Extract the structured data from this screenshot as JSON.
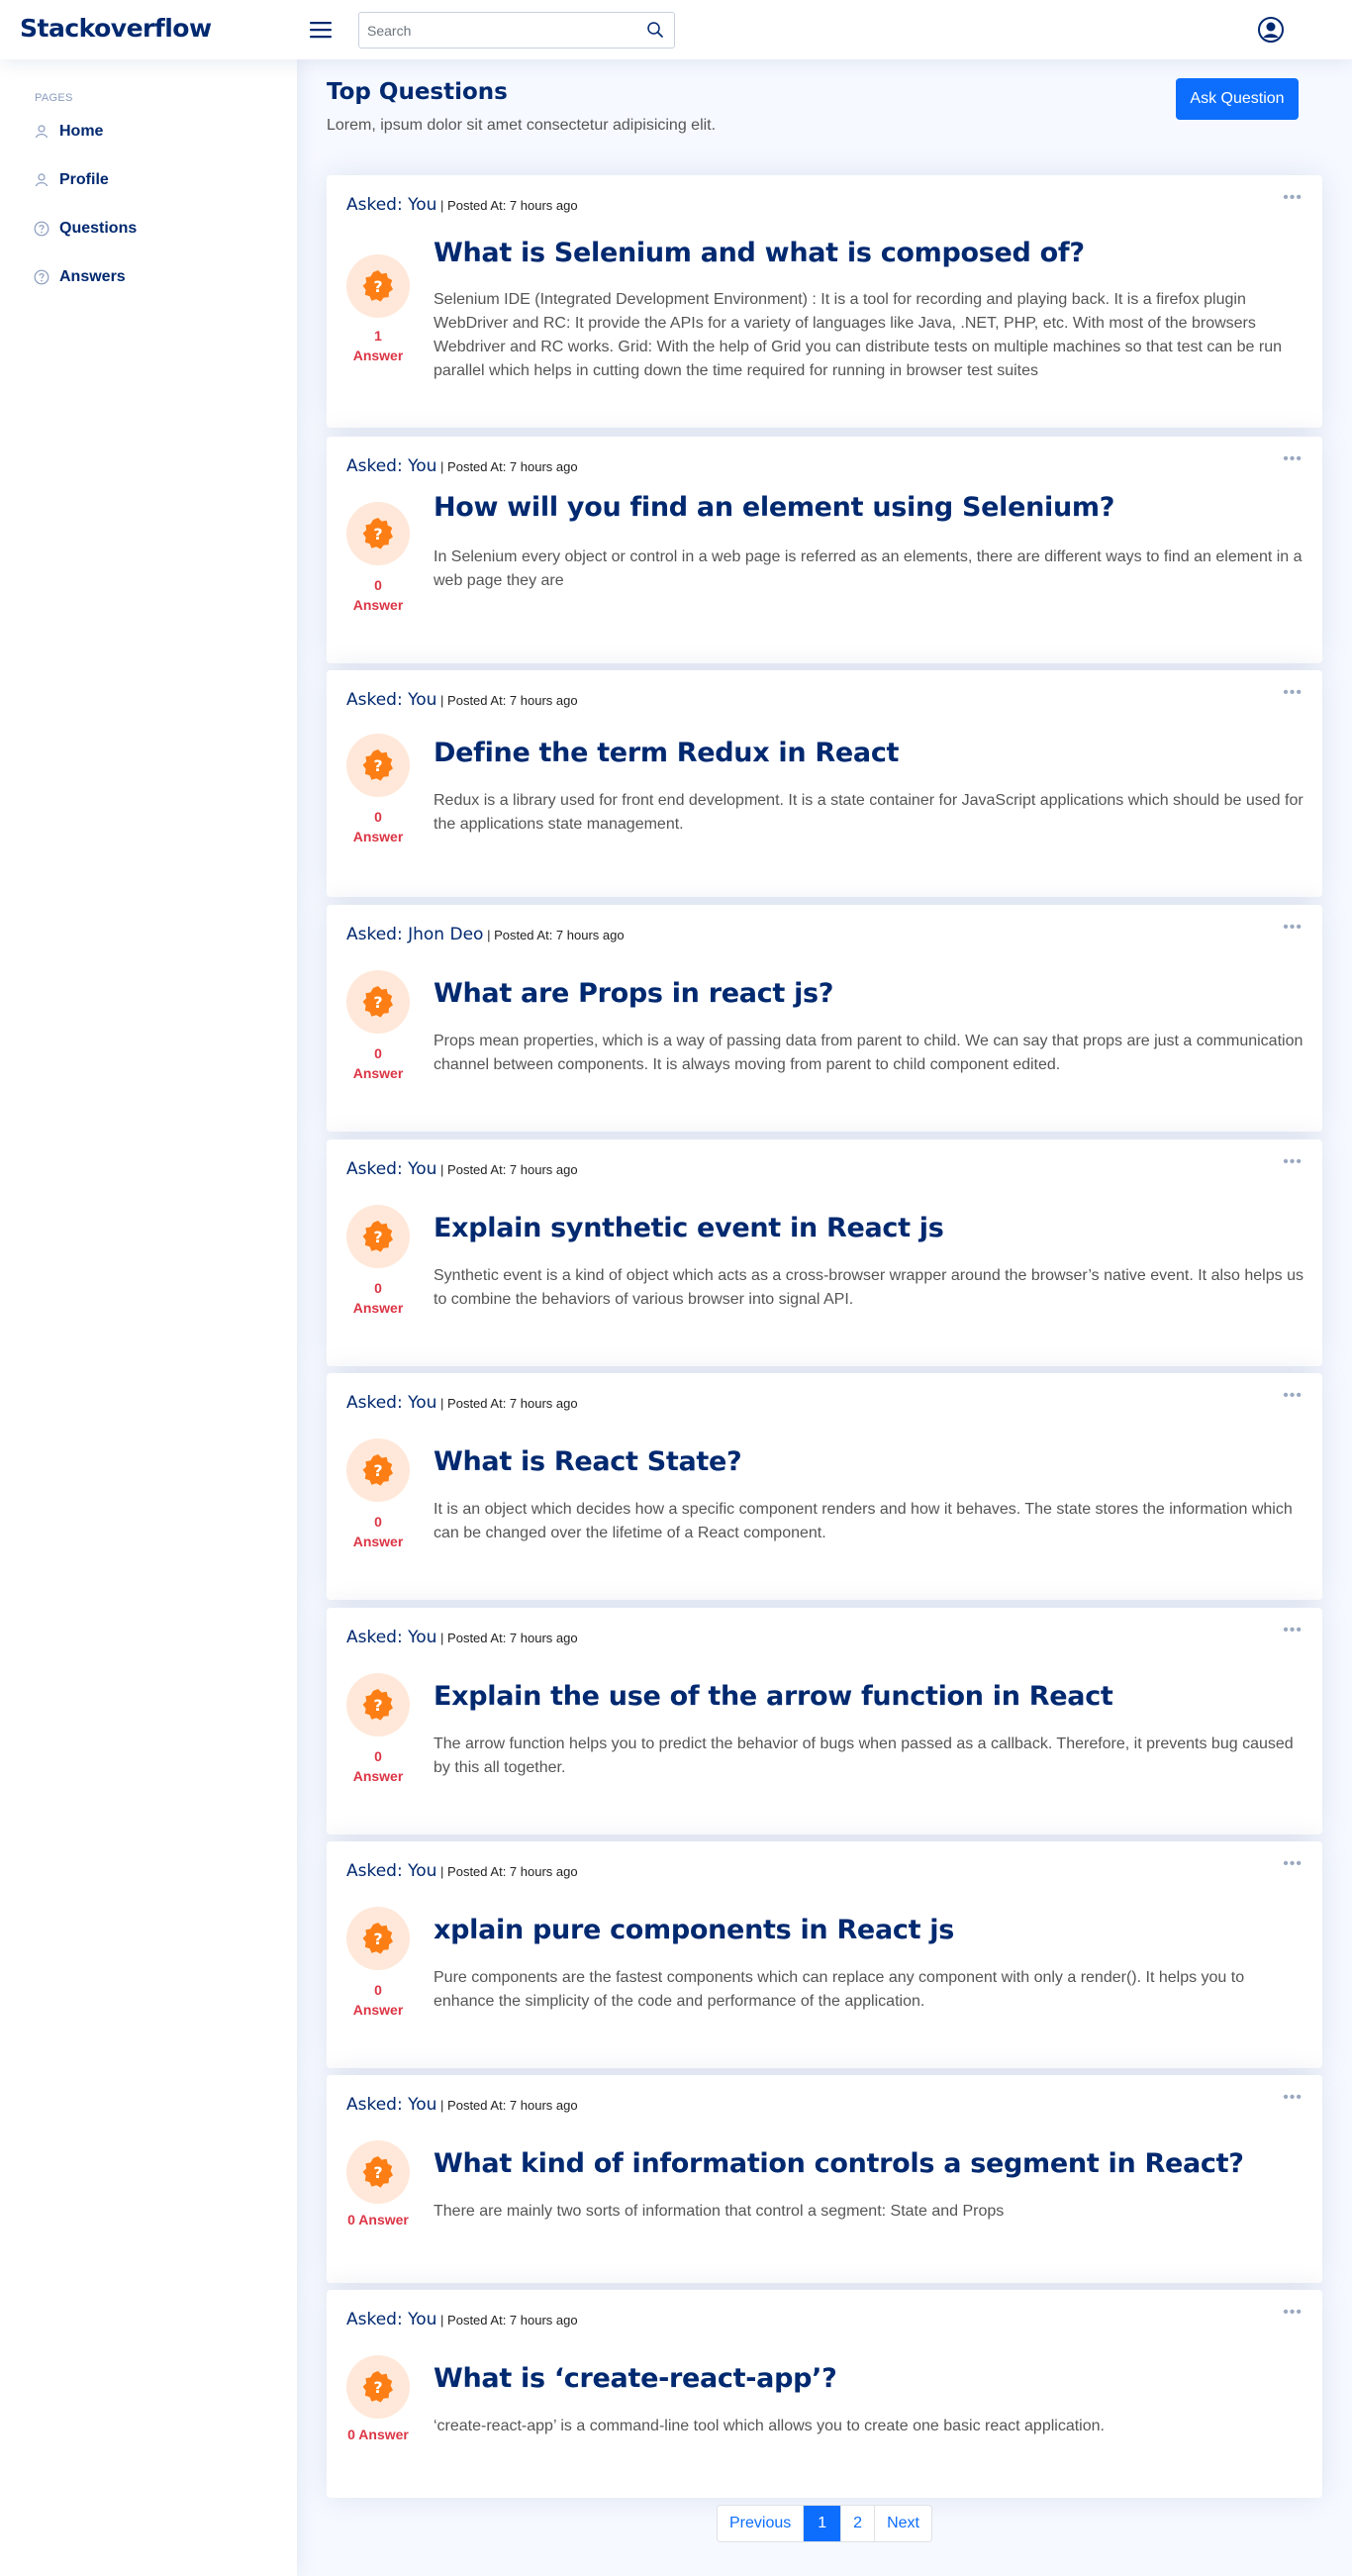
{
  "header": {
    "brand": "Stackoverflow",
    "search_placeholder": "Search"
  },
  "sidebar": {
    "heading": "PAGES",
    "items": [
      {
        "label": "Home",
        "icon": "person-icon"
      },
      {
        "label": "Profile",
        "icon": "person-icon"
      },
      {
        "label": "Questions",
        "icon": "question-circle-icon"
      },
      {
        "label": "Answers",
        "icon": "question-circle-icon"
      }
    ]
  },
  "main": {
    "title": "Top Questions",
    "subtitle": "Lorem, ipsum dolor sit amet consectetur adipisicing elit.",
    "ask_button": "Ask Question"
  },
  "questions": [
    {
      "asked": "Asked: You",
      "posted": "Posted At: 7 hours ago",
      "answers_num": "1",
      "answers_label": "Answer",
      "title": "What is Selenium and what is composed of?",
      "body": "Selenium IDE (Integrated Development Environment) : It is a tool for recording and playing back. It is a firefox plugin WebDriver and RC: It provide the APIs for a variety of languages like Java, .NET, PHP, etc. With most of the browsers Webdriver and RC works. Grid: With the help of Grid you can distribute tests on multiple machines so that test can be run parallel which helps in cutting down the time required for running in browser test suites"
    },
    {
      "asked": "Asked: You",
      "posted": "Posted At: 7 hours ago",
      "answers_num": "0",
      "answers_label": "Answer",
      "title": "How will you find an element using Selenium?",
      "body": "In Selenium every object or control in a web page is referred as an elements, there are different ways to find an element in a web page they are"
    },
    {
      "asked": "Asked: You",
      "posted": "Posted At: 7 hours ago",
      "answers_num": "0",
      "answers_label": "Answer",
      "title": "Define the term Redux in React",
      "body": "Redux is a library used for front end development. It is a state container for JavaScript applications which should be used for the applications state management."
    },
    {
      "asked": "Asked: Jhon Deo",
      "posted": "Posted At: 7 hours ago",
      "answers_num": "0",
      "answers_label": "Answer",
      "title": "What are Props in react js?",
      "body": "Props mean properties, which is a way of passing data from parent to child. We can say that props are just a communication channel between components. It is always moving from parent to child component edited."
    },
    {
      "asked": "Asked: You",
      "posted": "Posted At: 7 hours ago",
      "answers_num": "0",
      "answers_label": "Answer",
      "title": "Explain synthetic event in React js",
      "body": "Synthetic event is a kind of object which acts as a cross-browser wrapper around the browser’s native event. It also helps us to combine the behaviors of various browser into signal API."
    },
    {
      "asked": "Asked: You",
      "posted": "Posted At: 7 hours ago",
      "answers_num": "0",
      "answers_label": "Answer",
      "title": "What is React State?",
      "body": "It is an object which decides how a specific component renders and how it behaves. The state stores the information which can be changed over the lifetime of a React component."
    },
    {
      "asked": "Asked: You",
      "posted": "Posted At: 7 hours ago",
      "answers_num": "0",
      "answers_label": "Answer",
      "title": "Explain the use of the arrow function in React",
      "body": "The arrow function helps you to predict the behavior of bugs when passed as a callback. Therefore, it prevents bug caused by this all together."
    },
    {
      "asked": "Asked: You",
      "posted": "Posted At: 7 hours ago",
      "answers_num": "0",
      "answers_label": "Answer",
      "title": "xplain pure components in React js",
      "body": "Pure components are the fastest components which can replace any component with only a render(). It helps you to enhance the simplicity of the code and performance of the application."
    },
    {
      "asked": "Asked: You",
      "posted": "Posted At: 7 hours ago",
      "answers_num": "0",
      "answers_label": "Answer",
      "title": "What kind of information controls a segment in React?",
      "body": "There are mainly two sorts of information that control a segment: State and Props"
    },
    {
      "asked": "Asked: You",
      "posted": "Posted At: 7 hours ago",
      "answers_num": "0",
      "answers_label": "Answer",
      "title": "What is ‘create-react-app’?",
      "body": "‘create-react-app’ is a command-line tool which allows you to create one basic react application."
    }
  ],
  "pagination": {
    "previous": "Previous",
    "pages": [
      "1",
      "2"
    ],
    "next": "Next"
  },
  "colors": {
    "brand": "#012970",
    "accent": "#0d6efd",
    "answer": "#dc3545",
    "question_icon": "#fd7e14"
  }
}
